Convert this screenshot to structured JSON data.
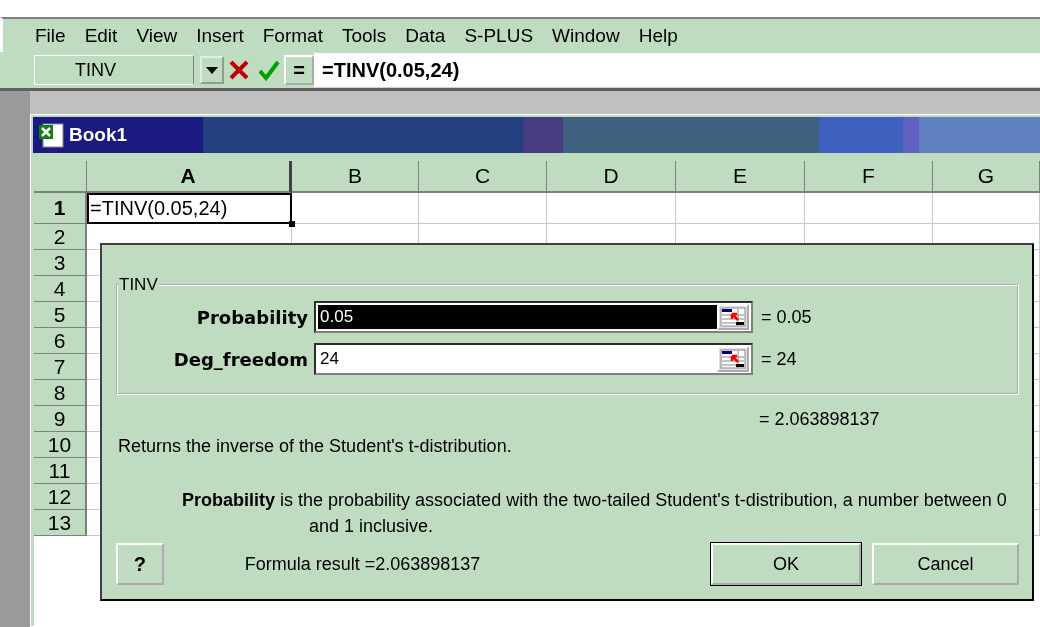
{
  "menu_bar": [
    {
      "label": "File"
    },
    {
      "label": "Edit"
    },
    {
      "label": "View"
    },
    {
      "label": "Insert"
    },
    {
      "label": "Format"
    },
    {
      "label": "Tools"
    },
    {
      "label": "Data"
    },
    {
      "label": "S-PLUS"
    },
    {
      "label": "Window"
    },
    {
      "label": "Help"
    }
  ],
  "formula_bar": {
    "name_box": "TINV",
    "equals": "=",
    "formula": "=TINV(0.05,24)"
  },
  "workbook": {
    "title": "Book1",
    "columns": [
      {
        "label": "A",
        "selected": true
      },
      {
        "label": "B",
        "selected": false
      },
      {
        "label": "C",
        "selected": false
      },
      {
        "label": "D",
        "selected": false
      },
      {
        "label": "E",
        "selected": false
      },
      {
        "label": "F",
        "selected": false
      },
      {
        "label": "G",
        "selected": false
      }
    ],
    "rows": [
      {
        "label": "1",
        "selected": true,
        "cells": [
          "=TINV(0.05,24)"
        ]
      },
      {
        "label": "2",
        "selected": false
      },
      {
        "label": "3",
        "selected": false
      },
      {
        "label": "4",
        "selected": false
      },
      {
        "label": "5",
        "selected": false
      },
      {
        "label": "6",
        "selected": false
      },
      {
        "label": "7",
        "selected": false
      },
      {
        "label": "8",
        "selected": false
      },
      {
        "label": "9",
        "selected": false
      },
      {
        "label": "10",
        "selected": false
      },
      {
        "label": "11",
        "selected": false
      },
      {
        "label": "12",
        "selected": false
      },
      {
        "label": "13",
        "selected": false
      }
    ]
  },
  "dialog": {
    "group_title": "TINV",
    "arguments": [
      {
        "label": "Probability",
        "value": "0.05",
        "selected": true,
        "result": "= 0.05"
      },
      {
        "label": "Deg_freedom",
        "value": "24",
        "selected": false,
        "result": "= 24"
      }
    ],
    "function_result": "= 2.063898137",
    "description": "Returns the inverse of the Student's t-distribution.",
    "argument_help": "**Probability** is the probability associated with the two-tailed Student's t-distribution, a number between 0 and 1 inclusive.",
    "help_button": "?",
    "formula_result": "Formula result =2.063898137",
    "buttons": [
      "OK",
      "Cancel"
    ]
  }
}
